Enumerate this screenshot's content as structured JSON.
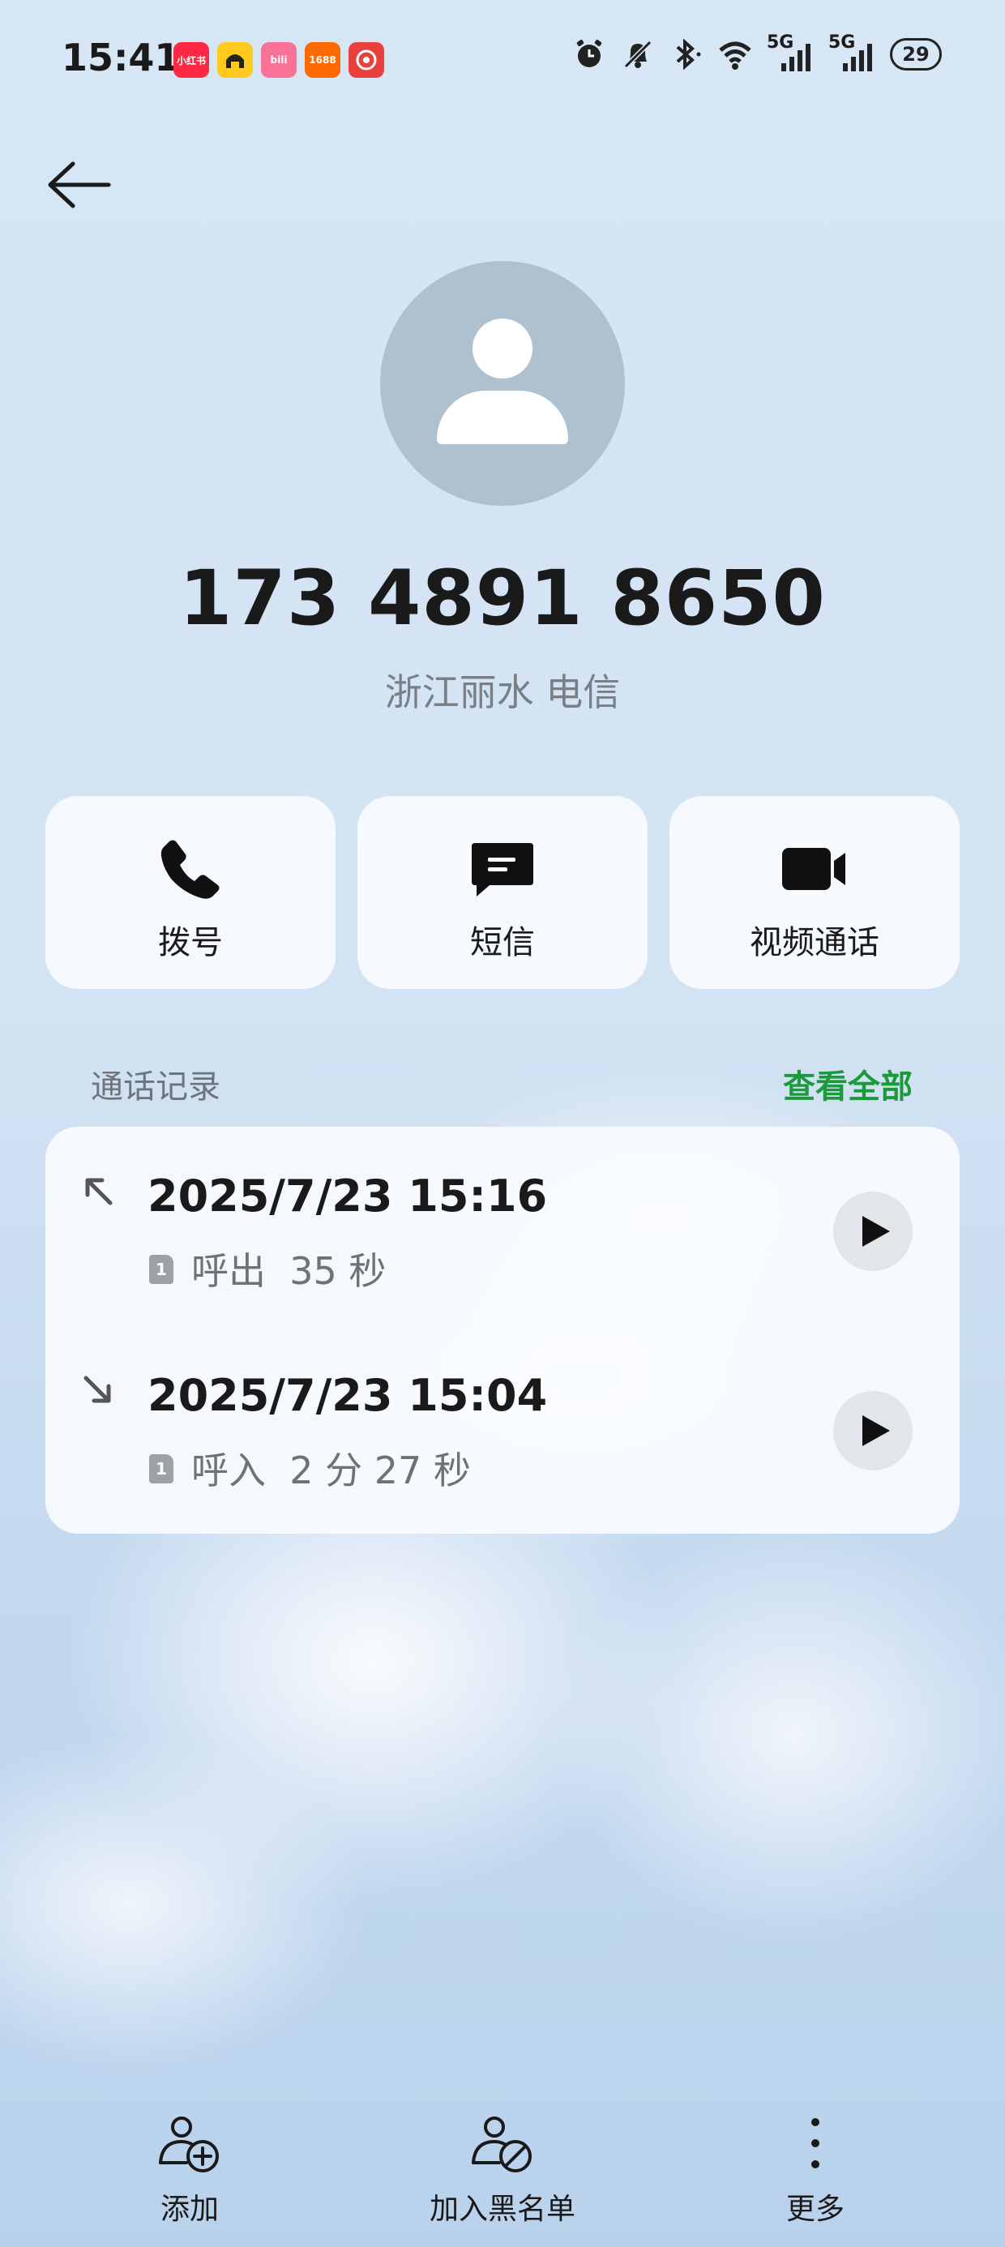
{
  "status_bar": {
    "time": "15:41",
    "apps": [
      {
        "name": "xiaohongshu-icon",
        "text": "小红书",
        "color": "#ff2741"
      },
      {
        "name": "amap-icon",
        "text": "",
        "color": "#ffc91e"
      },
      {
        "name": "bilibili-icon",
        "text": "bili",
        "color": "#fb7299"
      },
      {
        "name": "1688-icon",
        "text": "1688",
        "color": "#ff6a00"
      },
      {
        "name": "shopping-icon",
        "text": "",
        "color": "#e8403d"
      }
    ],
    "signal_5g_a": "5G",
    "signal_5g_b": "5G",
    "battery": "29"
  },
  "contact": {
    "number": "173 4891 8650",
    "location": "浙江丽水 电信"
  },
  "actions": {
    "call": "拨号",
    "sms": "短信",
    "video": "视频通话"
  },
  "call_log": {
    "title": "通话记录",
    "view_all": "查看全部",
    "entries": [
      {
        "datetime": "2025/7/23 15:16",
        "sim": "1",
        "detail": "呼出  35 秒",
        "direction": "outgoing"
      },
      {
        "datetime": "2025/7/23 15:04",
        "sim": "1",
        "detail": "呼入  2 分 27 秒",
        "direction": "incoming"
      }
    ]
  },
  "bottom_bar": {
    "add": "添加",
    "block": "加入黑名单",
    "more": "更多"
  }
}
